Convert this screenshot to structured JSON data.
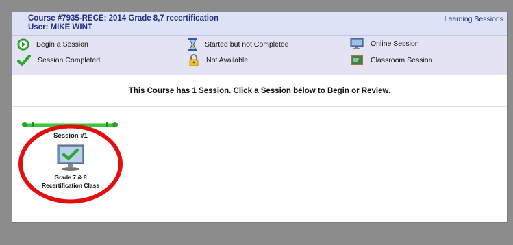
{
  "header": {
    "course_title": "Course #7935-RECE: 2014 Grade 8,7 recertification",
    "user": "User: MIKE WINT",
    "learning_sessions_link": "Learning Sessions"
  },
  "legend": {
    "begin": "Begin a Session",
    "completed": "Session Completed",
    "started": "Started but not Completed",
    "not_available": "Not Available",
    "online": "Online Session",
    "classroom": "Classroom Session"
  },
  "notice": "This Course has 1 Session. Click a Session below to Begin or Review.",
  "sessions": [
    {
      "label": "Session #1",
      "name_line1": "Grade 7 & 8",
      "name_line2": "Recertification Class",
      "status": "completed",
      "type": "online"
    }
  ],
  "colors": {
    "header_bg": "#dde2f6",
    "title_color": "#1c2f7e",
    "legend_bg": "#e3e3f3",
    "check_green": "#2fa52f",
    "circle_red": "#e30e0e"
  },
  "icons": [
    "play-icon",
    "checkmark-icon",
    "hourglass-icon",
    "lock-icon",
    "monitor-icon",
    "chalkboard-icon"
  ]
}
